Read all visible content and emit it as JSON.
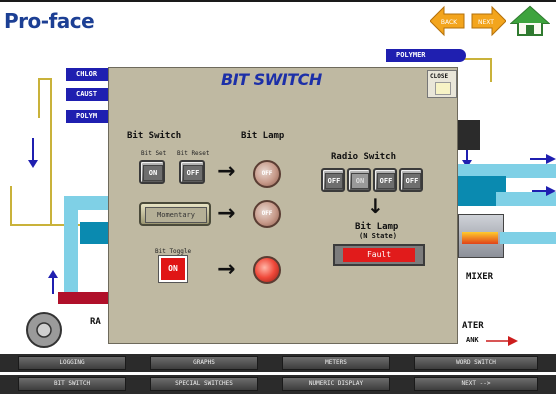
{
  "app": {
    "logo": "Pro-face"
  },
  "nav": {
    "back": "BACK",
    "next": "NEXT"
  },
  "tags": {
    "chlor": "CHLOR",
    "caust": "CAUST",
    "polym_left": "POLYM",
    "polymer": "POLYMER"
  },
  "plant": {
    "mixer": "MIXER",
    "ra": "RA",
    "water": "ATER",
    "tank": "ANK"
  },
  "dialog": {
    "title": "BIT SWITCH",
    "close": "CLOSE",
    "bit_switch_heading": "Bit Switch",
    "bit_lamp_heading": "Bit Lamp",
    "bit_set_label": "Bit Set",
    "bit_reset_label": "Bit Reset",
    "on_label": "ON",
    "off_label": "OFF",
    "momentary_label": "Momentary",
    "bit_toggle_label": "Bit Toggle",
    "toggle_on_label": "ON",
    "lamp1": "OFF",
    "lamp2": "OFF",
    "lamp3": "",
    "radio_heading": "Radio Switch",
    "radio_buttons": [
      "OFF",
      "ON",
      "OFF",
      "OFF"
    ],
    "bit_lamp_n": "Bit Lamp",
    "n_state": "(N State)",
    "fault": "Fault"
  },
  "bottom_menu": {
    "row1": [
      "LOGGING",
      "GRAPHS",
      "METERS",
      "WORD SWITCH"
    ],
    "row2": [
      "BIT SWITCH",
      "SPECIAL SWITCHES",
      "NUMERIC DISPLAY",
      "NEXT -->"
    ]
  },
  "colors": {
    "accent": "#1c3f94",
    "dialog_bg": "#bfb9a2",
    "tag_blue": "#1f1fb0",
    "pipe_light": "#7fd0e6",
    "pipe_dark": "#0a8ab0",
    "fault_red": "#e11b1b"
  }
}
